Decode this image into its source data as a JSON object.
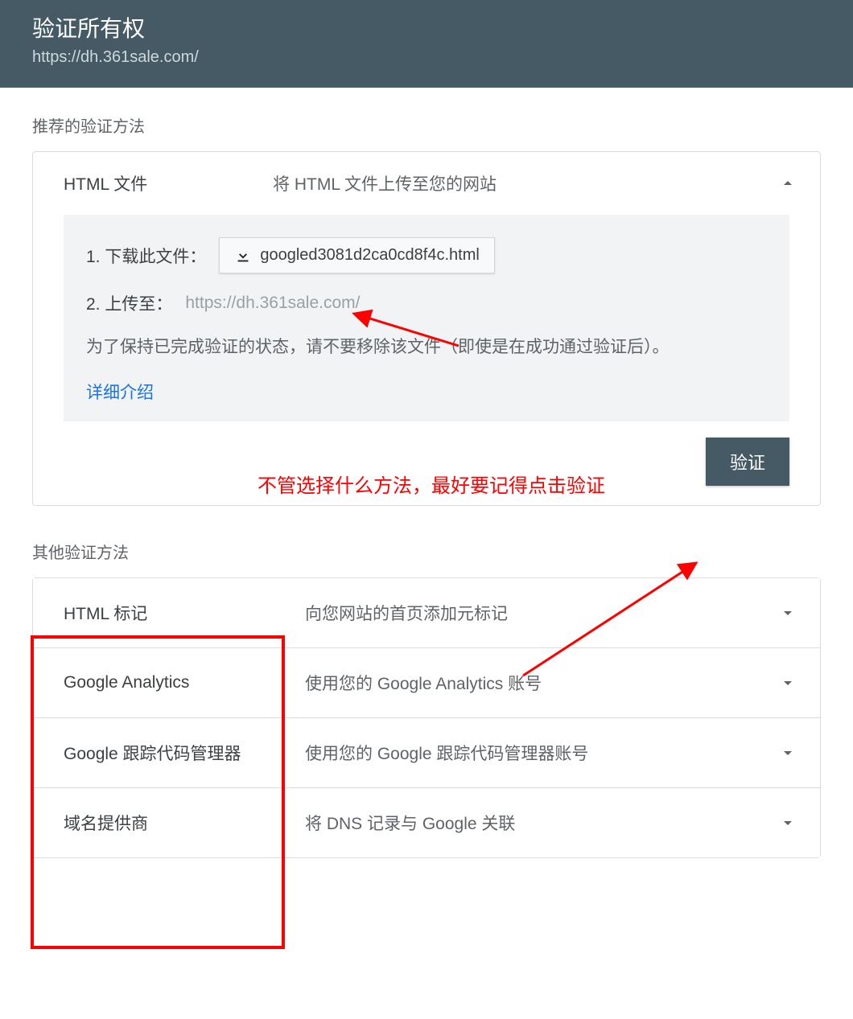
{
  "header": {
    "title": "验证所有权",
    "url": "https://dh.361sale.com/"
  },
  "recommended": {
    "label": "推荐的验证方法",
    "method": {
      "name": "HTML 文件",
      "desc": "将 HTML 文件上传至您的网站",
      "step1_label": "1. 下载此文件：",
      "download_filename": "googled3081d2ca0cd8f4c.html",
      "step2_label": "2. 上传至：",
      "upload_url": "https://dh.361sale.com/",
      "note": "为了保持已完成验证的状态，请不要移除该文件（即使是在成功通过验证后）。",
      "learn_more": "详细介绍",
      "verify_button": "验证"
    }
  },
  "other": {
    "label": "其他验证方法",
    "methods": [
      {
        "name": "HTML 标记",
        "desc": "向您网站的首页添加元标记"
      },
      {
        "name": "Google Analytics",
        "desc": "使用您的 Google Analytics 账号"
      },
      {
        "name": "Google 跟踪代码管理器",
        "desc": "使用您的 Google 跟踪代码管理器账号"
      },
      {
        "name": "域名提供商",
        "desc": "将 DNS 记录与 Google 关联"
      }
    ]
  },
  "annotation": {
    "text": "不管选择什么方法，最好要记得点击验证"
  }
}
